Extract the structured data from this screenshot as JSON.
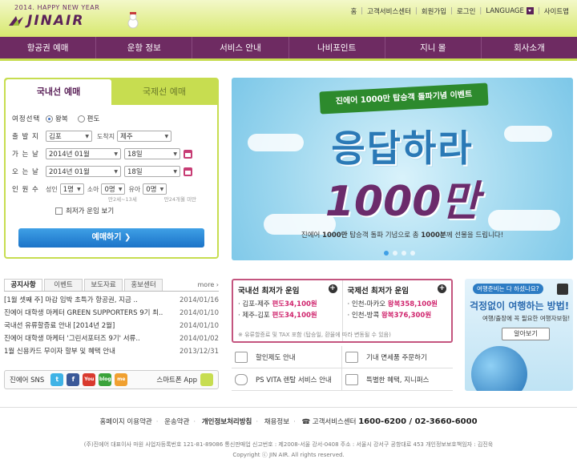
{
  "header": {
    "slogan": "2014. HAPPY NEW YEAR",
    "logo_text": "JINAIR",
    "util_nav": [
      "홈",
      "고객서비스센터",
      "회원가입",
      "로그인",
      "LANGUAGE",
      "사이트맵"
    ]
  },
  "gnb": [
    "항공권 예매",
    "운항 정보",
    "서비스 안내",
    "나비포인트",
    "지니 몰",
    "회사소개"
  ],
  "booking": {
    "tab_domestic": "국내선 예매",
    "tab_international": "국제선 예매",
    "trip_label": "여정선택",
    "trip_options": [
      "왕복",
      "편도"
    ],
    "from_label": "출 발 지",
    "from_value": "김포",
    "to_label": "도착지",
    "to_value": "제주",
    "depart_label": "가 는 날",
    "depart_month": "2014년 01월",
    "depart_day": "18일",
    "return_label": "오 는 날",
    "return_month": "2014년 01월",
    "return_day": "18일",
    "pax_label": "인 원 수",
    "adult_label": "성인",
    "adult_value": "1명",
    "child_label": "소아",
    "child_value": "0명",
    "infant_label": "유아",
    "infant_value": "0명",
    "child_hint": "만2세~13세",
    "infant_hint": "만24개월 미만",
    "lowest_fare_label": "최저가 운임 보기",
    "book_button": "예매하기"
  },
  "banner": {
    "ribbon": "진에어 1000만 탑승객 돌파기념 이벤트",
    "headline": "응답하라",
    "headline_2": "1000만",
    "copy_1": "진에어 ",
    "copy_bold_1": "1000만",
    "copy_2": " 탑승객 돌파 기념으로 총 ",
    "copy_bold_2": "1000분",
    "copy_3": "께 선물을 드립니다!"
  },
  "notice": {
    "tabs": [
      "공지사항",
      "이벤트",
      "보도자료",
      "홍보센터"
    ],
    "more": "more",
    "items": [
      {
        "title": "[1월 셋째 주] 마감 임박 초특가 항공권, 지금 ..",
        "date": "2014/01/16"
      },
      {
        "title": "진에어 대학생 마케터 GREEN SUPPORTERS 9기 최..",
        "date": "2014/01/10"
      },
      {
        "title": "국내선 유류할증료 안내 [2014년 2월]",
        "date": "2014/01/10"
      },
      {
        "title": "진에어 대학생 마케터 '그린서포터즈 9기' 서류..",
        "date": "2014/01/02"
      },
      {
        "title": "1월 신용카드 무이자 할부 및 혜택 안내",
        "date": "2013/12/31"
      }
    ],
    "sns_label": "진에어 SNS",
    "sns_icons": [
      "t",
      "f",
      "You",
      "blog",
      "me"
    ],
    "app_label": "스마트폰 App"
  },
  "fares": {
    "domestic_title": "국내선 최저가 운임",
    "domestic": [
      {
        "route": "김포-제주",
        "price": "편도34,100원"
      },
      {
        "route": "제주-김포",
        "price": "편도34,100원"
      }
    ],
    "intl_title": "국제선 최저가 운임",
    "intl": [
      {
        "route": "인천-마카오",
        "price": "왕복358,100원"
      },
      {
        "route": "인천-방콕",
        "price": "왕복376,300원"
      }
    ],
    "note": "※ 유류할증료 및 TAX 포함 (탑승일, 환율에 따라 변동될 수 있음)"
  },
  "quick": [
    "할인제도 안내",
    "기내 면세품 주문하기",
    "PS VITA 렌탈 서비스 안내",
    "특별한 혜택, 지니퍼스"
  ],
  "promo": {
    "tag": "여행준비는 다 하셨나요?",
    "title": "걱정없이 여행하는 방법!",
    "subtitle": "여행/출장에 꼭 필요한 여행자보험!",
    "button": "알아보기"
  },
  "footer": {
    "links": [
      "홈페이지 이용약관",
      "운송약관",
      "개인정보처리방침",
      "채용정보"
    ],
    "center_label": "고객서비스센터",
    "tel": "1600-6200 / 02-3660-6000",
    "address": "(주)진에어 대표이사 마원    사업자등록번호 121-81-89086    통신판매업 신고번호 : 제2008-서울 강서-0408    주소 : 서울시 강서구 공항대로 453    개인정보보호책임자 : 김진욱",
    "copyright": "Copyright ⓒ JIN AIR. All rights reserved."
  },
  "colors": {
    "brand_purple": "#6e2b62",
    "brand_green": "#c7dd50",
    "accent_pink": "#d0266e",
    "accent_blue": "#1b73c8"
  }
}
